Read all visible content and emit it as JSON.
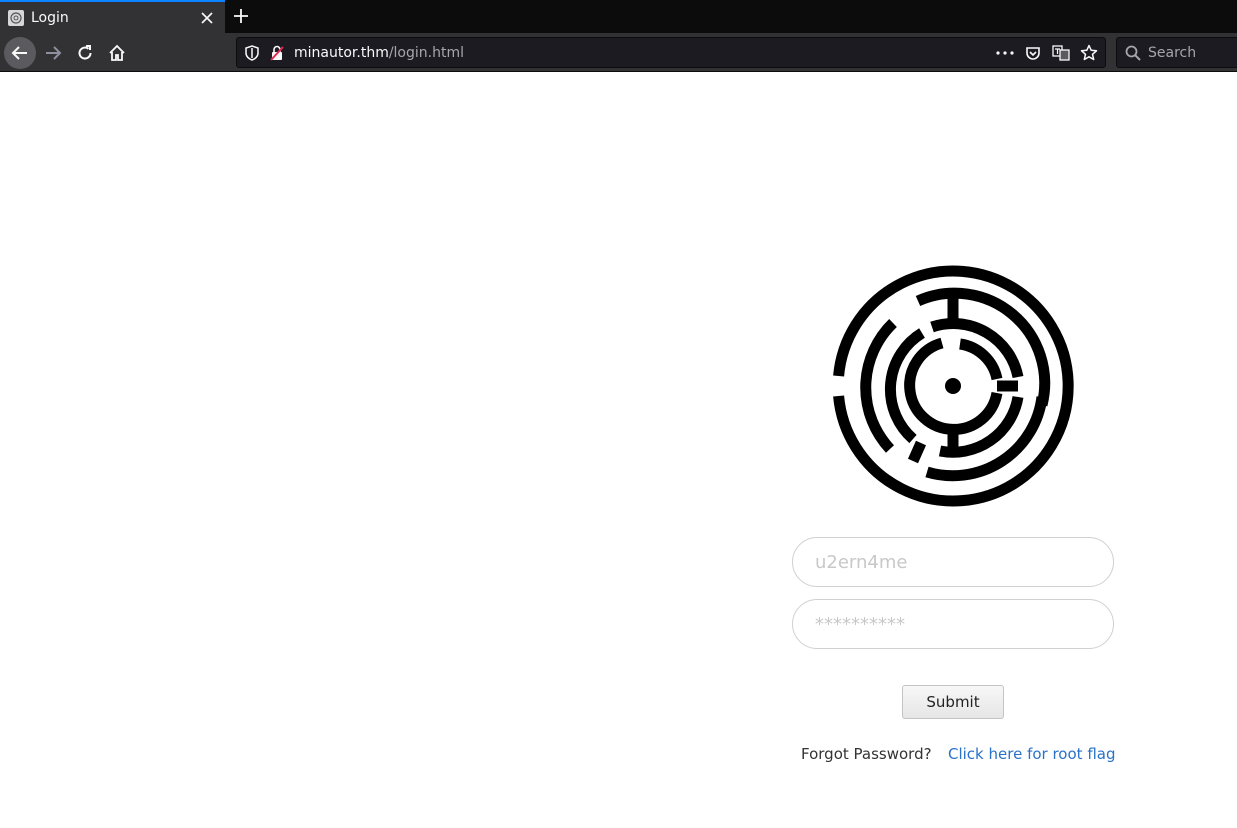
{
  "browser": {
    "tab": {
      "title": "Login",
      "close_icon": "close-icon",
      "favicon": "globe-icon"
    },
    "new_tab_icon": "plus-icon",
    "nav": {
      "back_icon": "arrow-left-icon",
      "forward_icon": "arrow-right-icon",
      "reload_icon": "reload-icon",
      "home_icon": "home-icon"
    },
    "url": {
      "host": "minautor.thm",
      "path": "/login.html"
    },
    "urlbar_actions": [
      "more-icon",
      "pocket-icon",
      "translate-icon",
      "bookmark-star-icon"
    ],
    "search_placeholder": "Search"
  },
  "login": {
    "logo": "maze-logo",
    "username_placeholder": "u2ern4me",
    "password_placeholder": "**********",
    "submit_label": "Submit",
    "forgot_text": "Forgot Password?",
    "root_flag_link": "Click here for root flag"
  },
  "colors": {
    "chrome_dark": "#0c0c0d",
    "chrome_bar": "#323234",
    "tab_accent": "#0a84ff",
    "link": "#2a72c8"
  }
}
